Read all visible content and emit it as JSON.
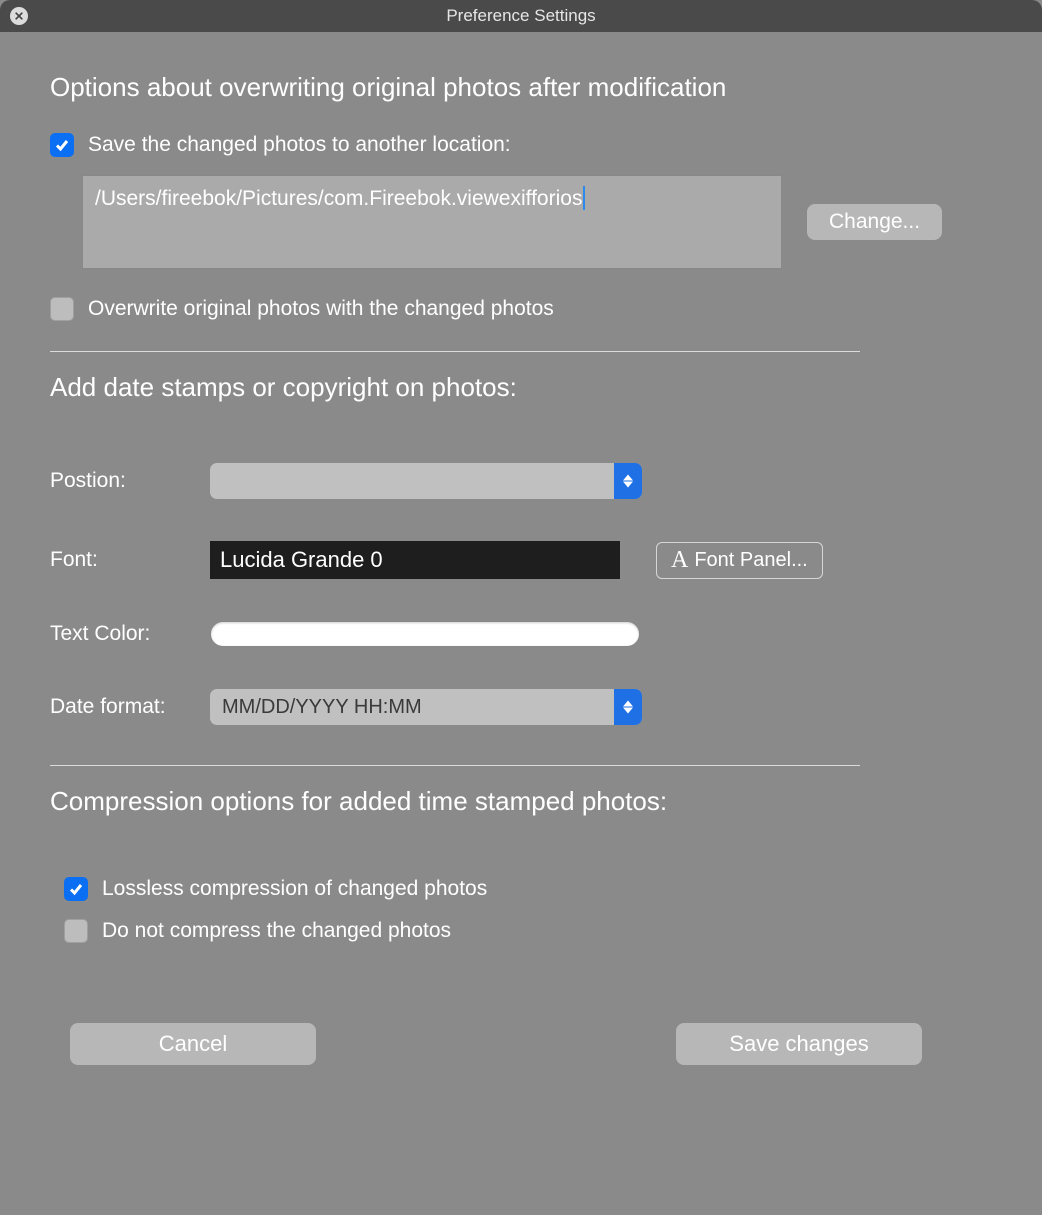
{
  "window": {
    "title": "Preference Settings"
  },
  "section1": {
    "heading": "Options about overwriting original photos after modification",
    "save_other_label": "Save the changed photos to another location:",
    "path_value": "/Users/fireebok/Pictures/com.Fireebok.viewexifforios",
    "change_button": "Change...",
    "overwrite_label": "Overwrite original photos with the changed photos"
  },
  "section2": {
    "heading": "Add date stamps or copyright on photos:",
    "position_label": "Postion:",
    "position_value": "",
    "font_label": "Font:",
    "font_value": "Lucida Grande 0",
    "font_panel_button": "Font Panel...",
    "text_color_label": "Text Color:",
    "date_format_label": "Date format:",
    "date_format_value": "MM/DD/YYYY HH:MM"
  },
  "section3": {
    "heading": "Compression options for added time stamped photos:",
    "lossless_label": "Lossless compression of changed photos",
    "no_compress_label": "Do not compress the changed photos"
  },
  "footer": {
    "cancel": "Cancel",
    "save": "Save changes"
  }
}
